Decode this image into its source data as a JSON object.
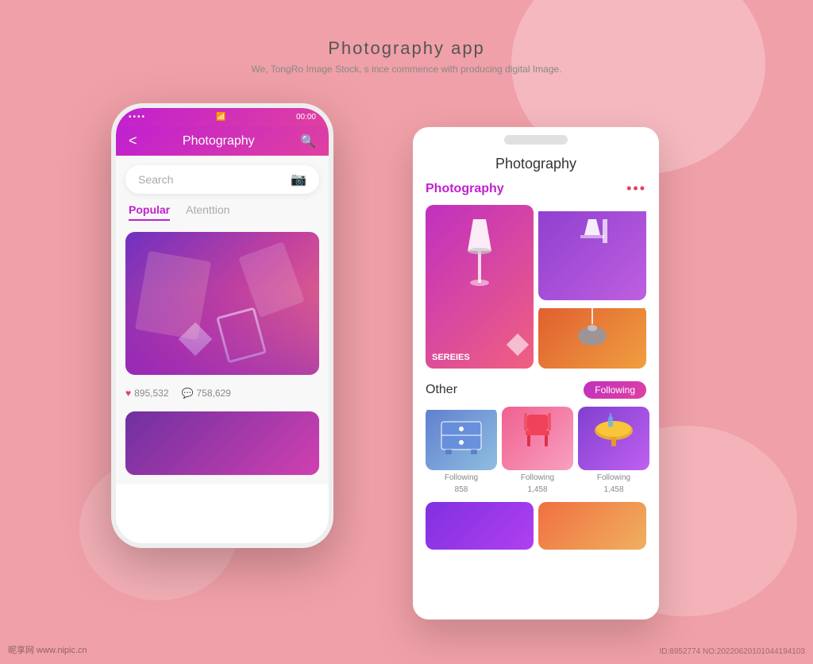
{
  "page": {
    "title": "Photography app",
    "subtitle": "We, TongRo Image Stock, s ince commence with producing  digital Image.",
    "bg_color": "#f0a0a8"
  },
  "phone1": {
    "status": {
      "dots": "••••",
      "wifi": "wifi",
      "time": "00:00",
      "battery": "🔋"
    },
    "navbar": {
      "back": "<",
      "title": "Photography",
      "search": "🔍"
    },
    "search_placeholder": "Search",
    "tabs": [
      "Popular",
      "Atenttion"
    ],
    "active_tab": 0,
    "stats": {
      "likes": "895,532",
      "comments": "758,629"
    }
  },
  "phone2": {
    "title": "Photography",
    "section1": {
      "label": "Photography",
      "dots": "•••",
      "series_label": "SEREIES"
    },
    "section2": {
      "label": "Other",
      "following_btn": "Following"
    },
    "items": [
      {
        "label": "Following",
        "count": "858"
      },
      {
        "label": "Following",
        "count": "1,458"
      },
      {
        "label": "Following",
        "count": "1,458"
      }
    ]
  },
  "watermark": "昵享网 www.nipic.cn",
  "id_info": "ID:8952774 NO:20220620101044194103"
}
